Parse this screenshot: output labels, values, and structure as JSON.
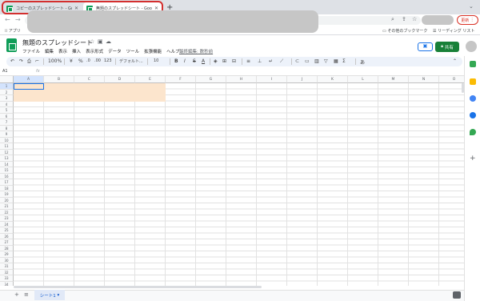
{
  "browser": {
    "tabs": [
      {
        "title": "コピーのスプレッドシート - Goog...",
        "active": false
      },
      {
        "title": "無題のスプレッドシート - Goog...",
        "active": true
      }
    ],
    "new_tab_icon": "plus-icon",
    "update_label": "更新",
    "bookmarks": {
      "apps_label": "アプリ",
      "other_label": "その他のブックマーク",
      "reading_label": "リーディング リスト"
    }
  },
  "sheets": {
    "doc_title": "無題のスプレッドシート",
    "menu": [
      "ファイル",
      "編集",
      "表示",
      "挿入",
      "表示形式",
      "データ",
      "ツール",
      "拡張機能",
      "ヘルプ"
    ],
    "last_edit": "最終編集: 数秒前",
    "share_label": "共有",
    "toolbar": {
      "zoom": "100%",
      "currency": "¥",
      "percent": "%",
      "decimal_dec": ".0",
      "decimal_inc": ".00",
      "more_formats": "123",
      "font": "デフォルト...",
      "font_size": "10",
      "bold": "B",
      "italic": "I",
      "strike": "S",
      "text_color": "A"
    },
    "name_box": "A1",
    "fx_label": "fx",
    "columns": [
      "A",
      "B",
      "C",
      "D",
      "E",
      "F",
      "G",
      "H",
      "I",
      "J",
      "K",
      "L",
      "M",
      "N",
      "O"
    ],
    "rows": [
      "1",
      "2",
      "3",
      "4",
      "5",
      "6",
      "7",
      "8",
      "9",
      "10",
      "11",
      "12",
      "13",
      "14",
      "15",
      "16",
      "17",
      "18",
      "19",
      "20",
      "21",
      "22",
      "23",
      "24",
      "25",
      "26",
      "27",
      "28",
      "29",
      "30",
      "31",
      "32",
      "33",
      "34",
      "35"
    ],
    "selected_cell": "A1",
    "fill_color": "#fce5cd",
    "sheet_tab": "シート1",
    "accent_color": "#188038"
  }
}
